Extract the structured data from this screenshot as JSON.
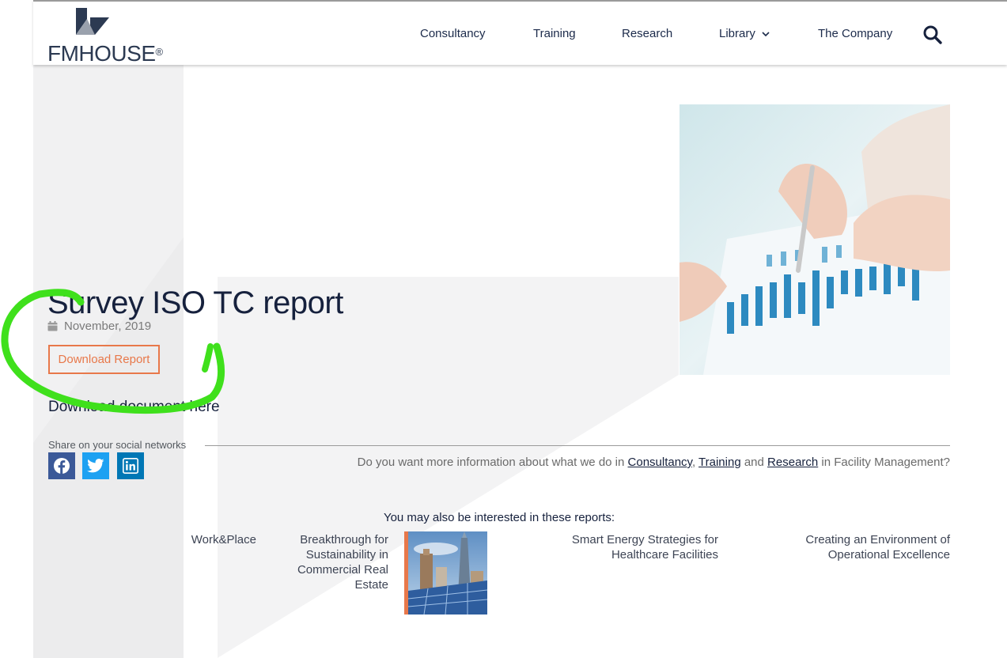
{
  "brand": {
    "name": "FMHOUSE",
    "registered": "®"
  },
  "nav": {
    "items": [
      {
        "label": "Consultancy"
      },
      {
        "label": "Training"
      },
      {
        "label": "Research"
      },
      {
        "label": "Library"
      },
      {
        "label": "The Company"
      }
    ],
    "search_icon": "search-icon"
  },
  "report": {
    "title": "Survey ISO TC report",
    "date": "November, 2019",
    "download_label": "Download Report",
    "document_text": "Download document here"
  },
  "share": {
    "label": "Share on your social networks",
    "networks": [
      {
        "name": "facebook",
        "color": "#3b5998"
      },
      {
        "name": "twitter",
        "color": "#1da1f2"
      },
      {
        "name": "linkedin",
        "color": "#0077b5"
      }
    ]
  },
  "info": {
    "prefix": "Do you want more information about what we do in ",
    "link1": "Consultancy",
    "sep1": ", ",
    "link2": "Training",
    "sep2": " and ",
    "link3": "Research",
    "suffix": " in Facility Management?"
  },
  "related": {
    "heading": "You may also be interested in these reports:",
    "items": [
      {
        "title": "Work&Place"
      },
      {
        "title": "Breakthrough for Sustainability in Commercial Real Estate"
      },
      {
        "title": "Smart Energy Strategies for Healthcare Facilities"
      },
      {
        "title": "Creating an Environment of Operational Excellence"
      }
    ]
  },
  "colors": {
    "accent": "#e8784a",
    "navy": "#16213d",
    "highlighter": "#3fe01c"
  }
}
